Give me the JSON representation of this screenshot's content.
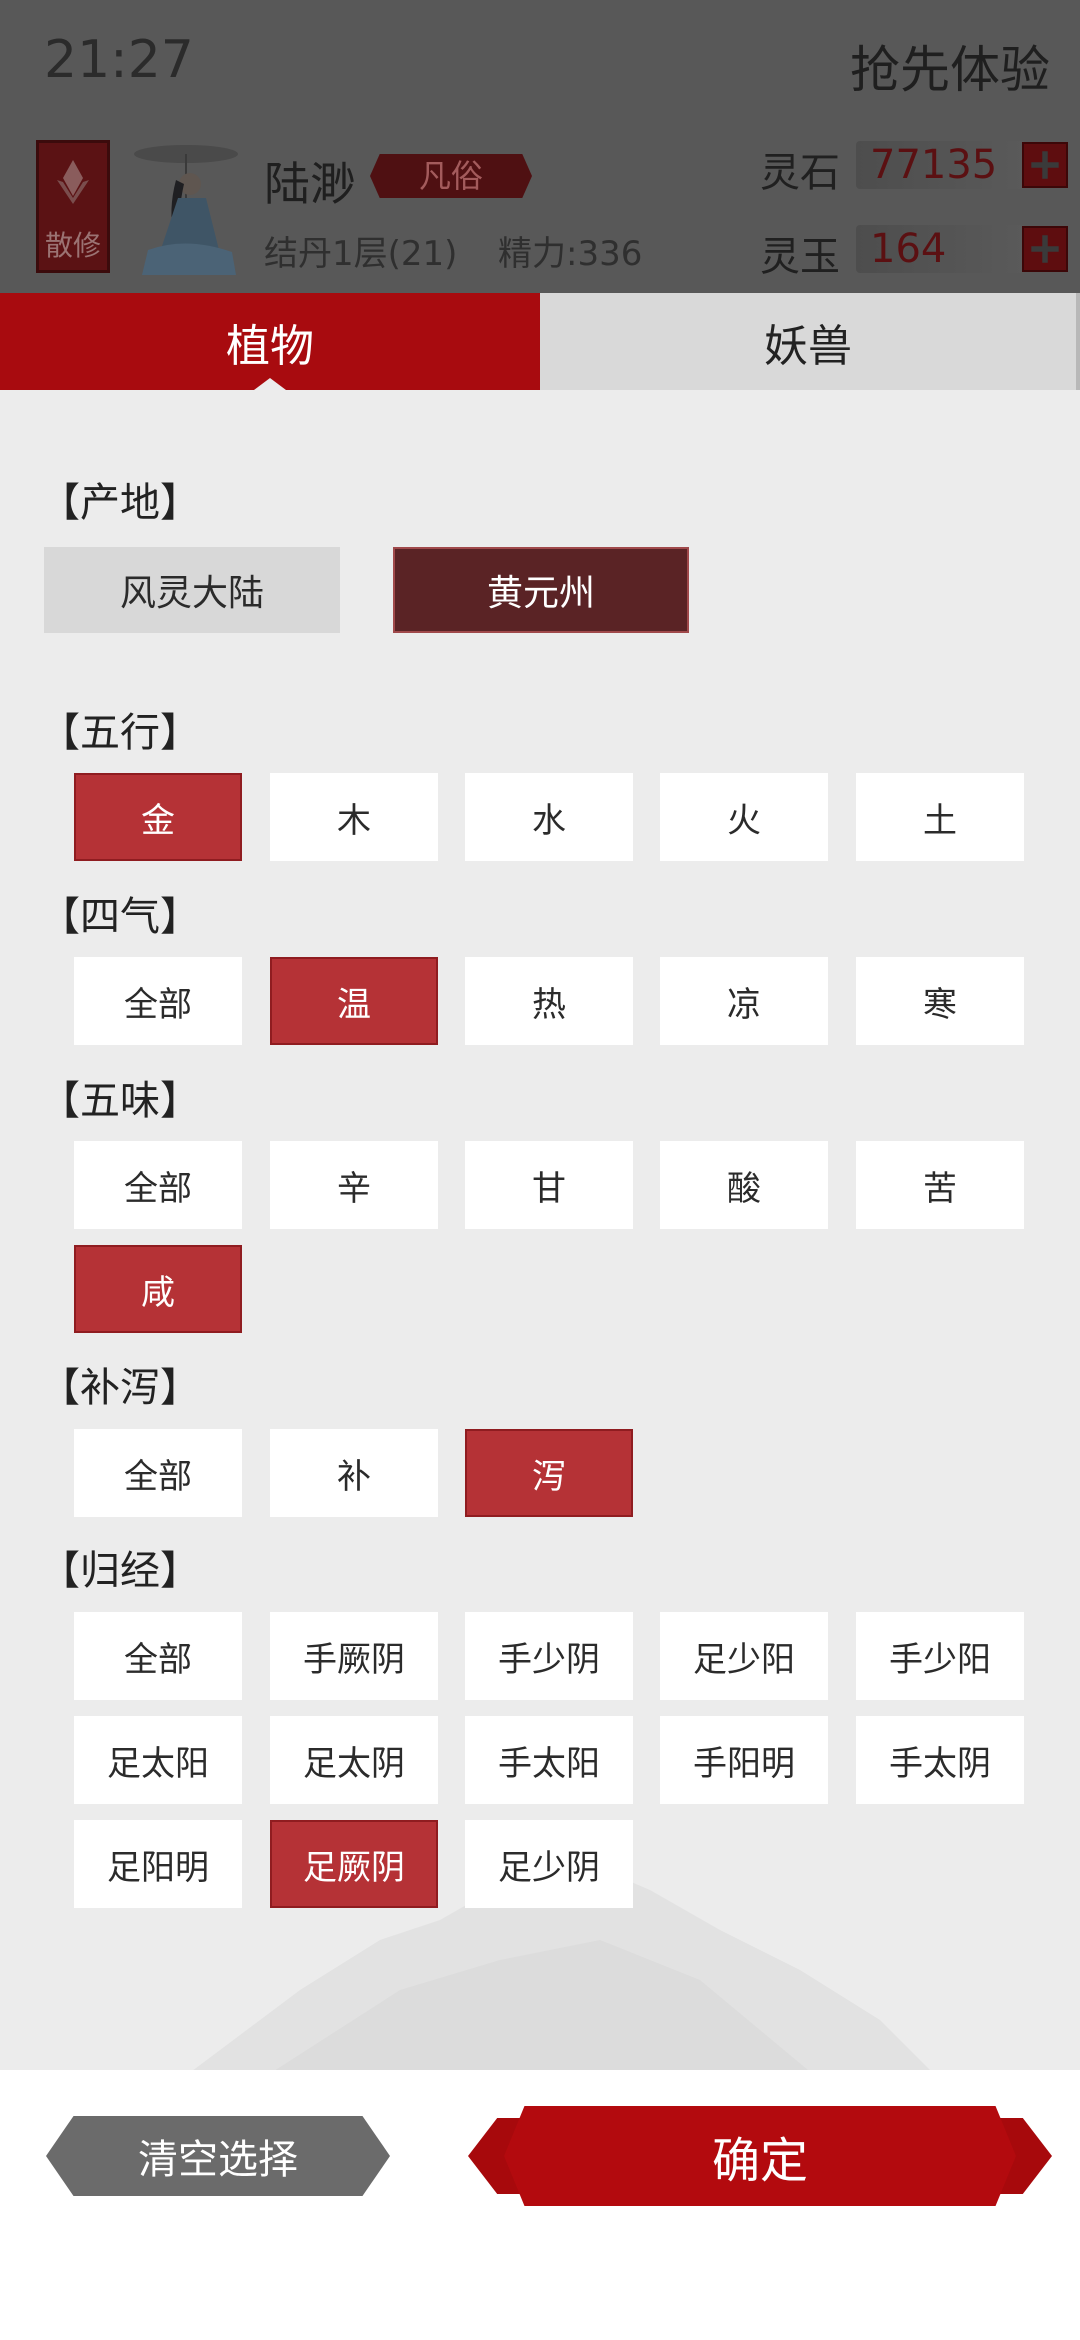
{
  "status_bar": {
    "time": "21:27"
  },
  "header": {
    "top_right": "抢先体验",
    "sect_badge": "散修",
    "name": "陆渺",
    "rank": "凡俗",
    "realm": "结丹1层(21)",
    "energy": "精力:336",
    "currencies": [
      {
        "label": "灵石",
        "value": "77135"
      },
      {
        "label": "灵玉",
        "value": "164"
      }
    ]
  },
  "tabs": [
    {
      "label": "植物",
      "active": true
    },
    {
      "label": "妖兽",
      "active": false
    }
  ],
  "filters": {
    "origin": {
      "title": "【产地】",
      "options": [
        {
          "label": "风灵大陆",
          "selected": false
        },
        {
          "label": "黄元州",
          "selected": true
        }
      ]
    },
    "elements": {
      "title": "【五行】",
      "options": [
        {
          "label": "金",
          "selected": true
        },
        {
          "label": "木",
          "selected": false
        },
        {
          "label": "水",
          "selected": false
        },
        {
          "label": "火",
          "selected": false
        },
        {
          "label": "土",
          "selected": false
        }
      ]
    },
    "four_qi": {
      "title": "【四气】",
      "options": [
        {
          "label": "全部",
          "selected": false
        },
        {
          "label": "温",
          "selected": true
        },
        {
          "label": "热",
          "selected": false
        },
        {
          "label": "凉",
          "selected": false
        },
        {
          "label": "寒",
          "selected": false
        }
      ]
    },
    "five_flavors": {
      "title": "【五味】",
      "options": [
        {
          "label": "全部",
          "selected": false
        },
        {
          "label": "辛",
          "selected": false
        },
        {
          "label": "甘",
          "selected": false
        },
        {
          "label": "酸",
          "selected": false
        },
        {
          "label": "苦",
          "selected": false
        },
        {
          "label": "咸",
          "selected": true
        }
      ]
    },
    "tonify_purge": {
      "title": "【补泻】",
      "options": [
        {
          "label": "全部",
          "selected": false
        },
        {
          "label": "补",
          "selected": false
        },
        {
          "label": "泻",
          "selected": true
        }
      ]
    },
    "meridians": {
      "title": "【归经】",
      "options": [
        {
          "label": "全部",
          "selected": false
        },
        {
          "label": "手厥阴",
          "selected": false
        },
        {
          "label": "手少阴",
          "selected": false
        },
        {
          "label": "足少阳",
          "selected": false
        },
        {
          "label": "手少阳",
          "selected": false
        },
        {
          "label": "足太阳",
          "selected": false
        },
        {
          "label": "足太阴",
          "selected": false
        },
        {
          "label": "手太阳",
          "selected": false
        },
        {
          "label": "手阳明",
          "selected": false
        },
        {
          "label": "手太阴",
          "selected": false
        },
        {
          "label": "足阳明",
          "selected": false
        },
        {
          "label": "足厥阴",
          "selected": true
        },
        {
          "label": "足少阴",
          "selected": false
        }
      ]
    }
  },
  "actions": {
    "clear_label": "清空选择",
    "confirm_label": "确定"
  },
  "colors": {
    "accent": "#a80b0f",
    "selected_chip": "#b53236",
    "selected_origin": "#5a2325"
  }
}
